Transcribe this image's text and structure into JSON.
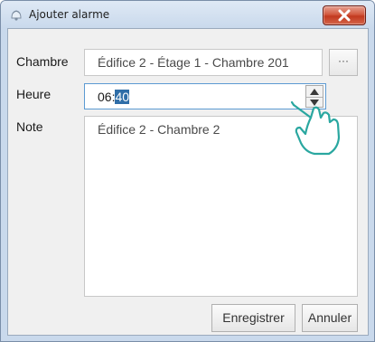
{
  "window": {
    "title": "Ajouter alarme"
  },
  "icons": {
    "app": "alarm-bell-icon",
    "close": "close-icon",
    "cursor": "hand-pointer-cursor-icon"
  },
  "form": {
    "room_label": "Chambre",
    "room_value": "Édifice 2 - Étage 1 - Chambre 201",
    "browse_label": "···",
    "time_label": "Heure",
    "time_hours": "06:",
    "time_minutes": "40",
    "note_label": "Note",
    "note_value": "Édifice 2 - Chambre 2"
  },
  "buttons": {
    "save": "Enregistrer",
    "cancel": "Annuler"
  },
  "colors": {
    "selection": "#2f6ea8",
    "close_button": "#c9442b",
    "focus_border": "#5c9ad2",
    "cursor_outline": "#2aa7a0"
  }
}
